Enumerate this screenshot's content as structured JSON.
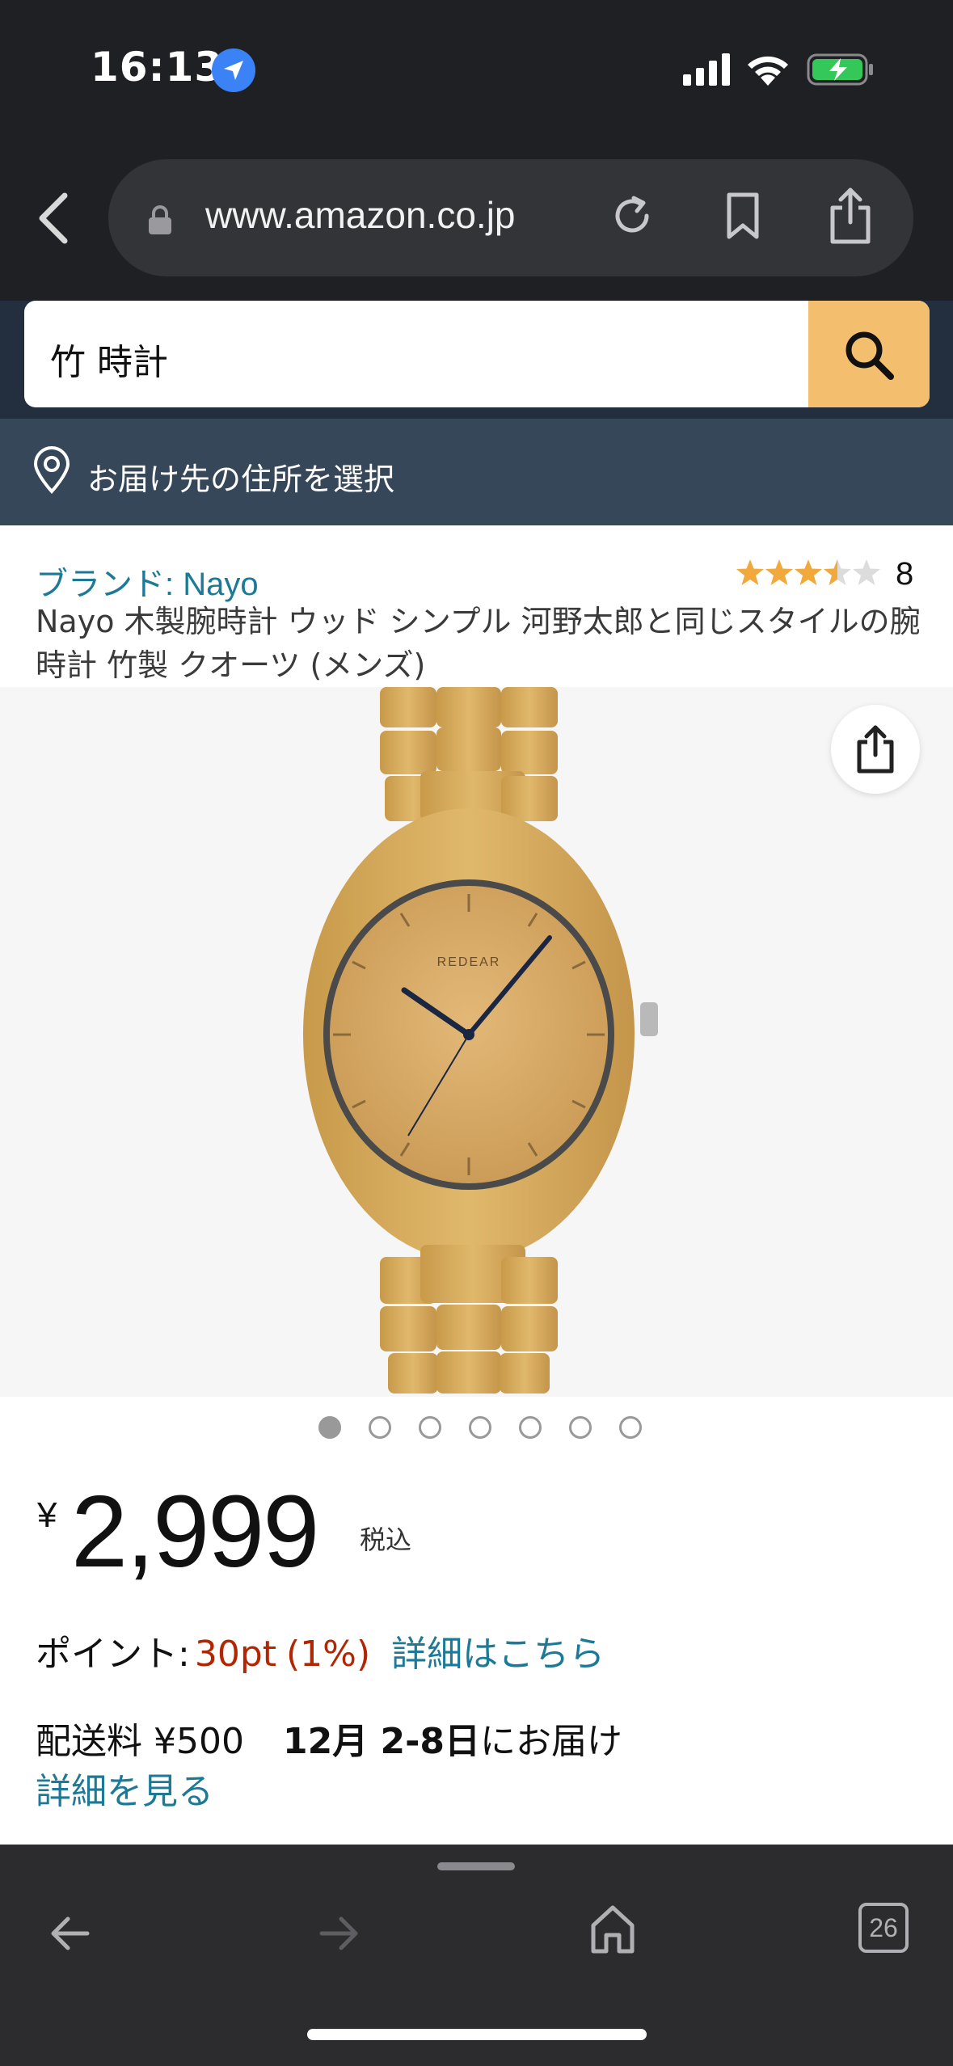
{
  "status_bar": {
    "time": "16:13"
  },
  "browser": {
    "url": "www.amazon.co.jp",
    "tab_count": "26"
  },
  "search": {
    "query": "竹 時計"
  },
  "delivery": {
    "label": "お届け先の住所を選択"
  },
  "product": {
    "brand": "ブランド: Nayo",
    "rating_stars": 3.5,
    "rating_count": "8",
    "title": "Nayo 木製腕時計 ウッド シンプル 河野太郎と同じスタイルの腕時計 竹製 クオーツ (メンズ)",
    "watch_logo_text": "REDEAR",
    "image_count": 7,
    "image_active_index": 0,
    "currency_symbol": "¥",
    "price": "2,999",
    "tax_label": "税込",
    "points_label": "ポイント:",
    "points_value": "30pt",
    "points_percent": "(1%)",
    "points_link": "詳細はこちら",
    "shipping_fee": "配送料 ¥500",
    "delivery_date": "12月 2-8日",
    "delivery_suffix": "にお届け",
    "details_link": "詳細を見る"
  },
  "colors": {
    "amazon_header": "#232f3e",
    "deliver_bar": "#37475a",
    "search_button": "#f3bf6e",
    "link": "#1c7a96",
    "price_points": "#b12704",
    "star": "#f2a93b"
  }
}
